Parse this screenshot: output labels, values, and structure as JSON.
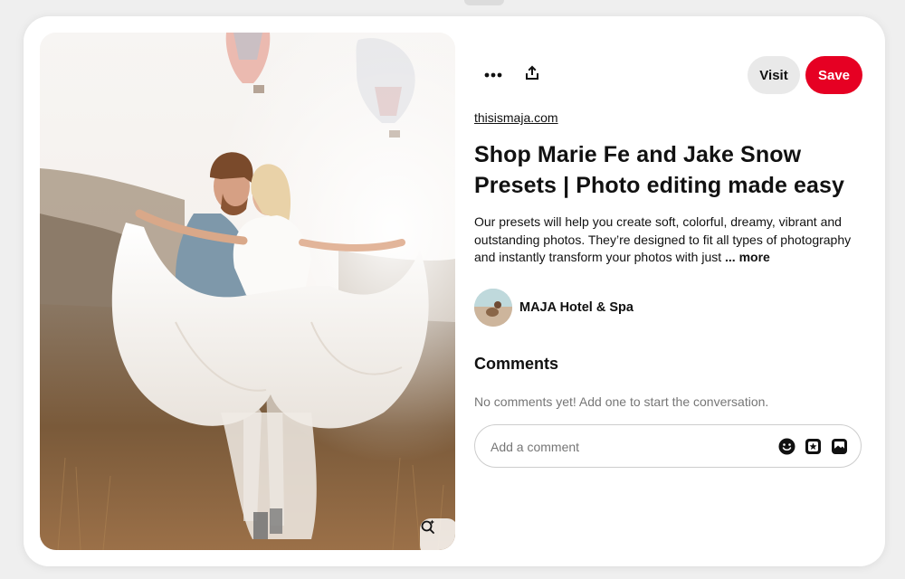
{
  "pin": {
    "source_link": "thisismaja.com",
    "title": "Shop Marie Fe and Jake Snow Presets | Photo editing made easy",
    "description": "Our presets will help you create soft, colorful, dreamy, vibrant and outstanding photos. They’re designed to fit all types of photography and instantly transform your photos with just",
    "more_label": "... more"
  },
  "toolbar": {
    "visit_label": "Visit",
    "save_label": "Save",
    "more_icon": "ellipsis-icon",
    "share_icon": "share-icon"
  },
  "creator": {
    "name": "MAJA Hotel & Spa"
  },
  "comments": {
    "heading": "Comments",
    "empty_text": "No comments yet! Add one to start the conversation.",
    "input_placeholder": "Add a comment",
    "input_value": ""
  },
  "icons": {
    "lens": "visual-search-icon",
    "emoji": "emoji-icon",
    "sticker": "sticker-icon",
    "image": "image-icon"
  },
  "colors": {
    "save": "#e60023",
    "visit": "#e9e9e9",
    "muted_text": "#767676"
  }
}
